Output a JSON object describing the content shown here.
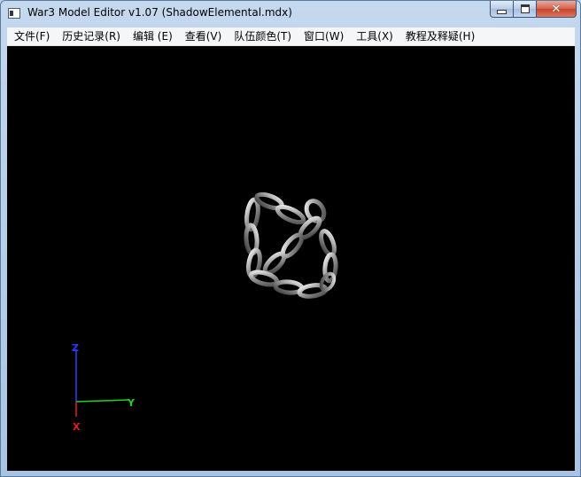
{
  "window": {
    "title": "War3 Model Editor v1.07 (ShadowElemental.mdx)",
    "icon": "app-icon"
  },
  "caption": {
    "minimize_icon": "minimize-icon",
    "maximize_icon": "maximize-icon",
    "close_icon": "close-icon",
    "close_color": "#c7452c"
  },
  "menu": {
    "items": [
      {
        "label": "文件(F)"
      },
      {
        "label": "历史记录(R)"
      },
      {
        "label": "编辑 (E)"
      },
      {
        "label": "查看(V)"
      },
      {
        "label": "队伍颜色(T)"
      },
      {
        "label": "窗口(W)"
      },
      {
        "label": "工具(X)"
      },
      {
        "label": "教程及释疑(H)"
      }
    ]
  },
  "viewport": {
    "background": "#000000",
    "model": "chain-links-model",
    "axes": {
      "z_label": "Z",
      "z_color": "#2a3cff",
      "y_label": "Y",
      "y_color": "#21d321",
      "x_label": "X",
      "x_color": "#e02020"
    }
  }
}
